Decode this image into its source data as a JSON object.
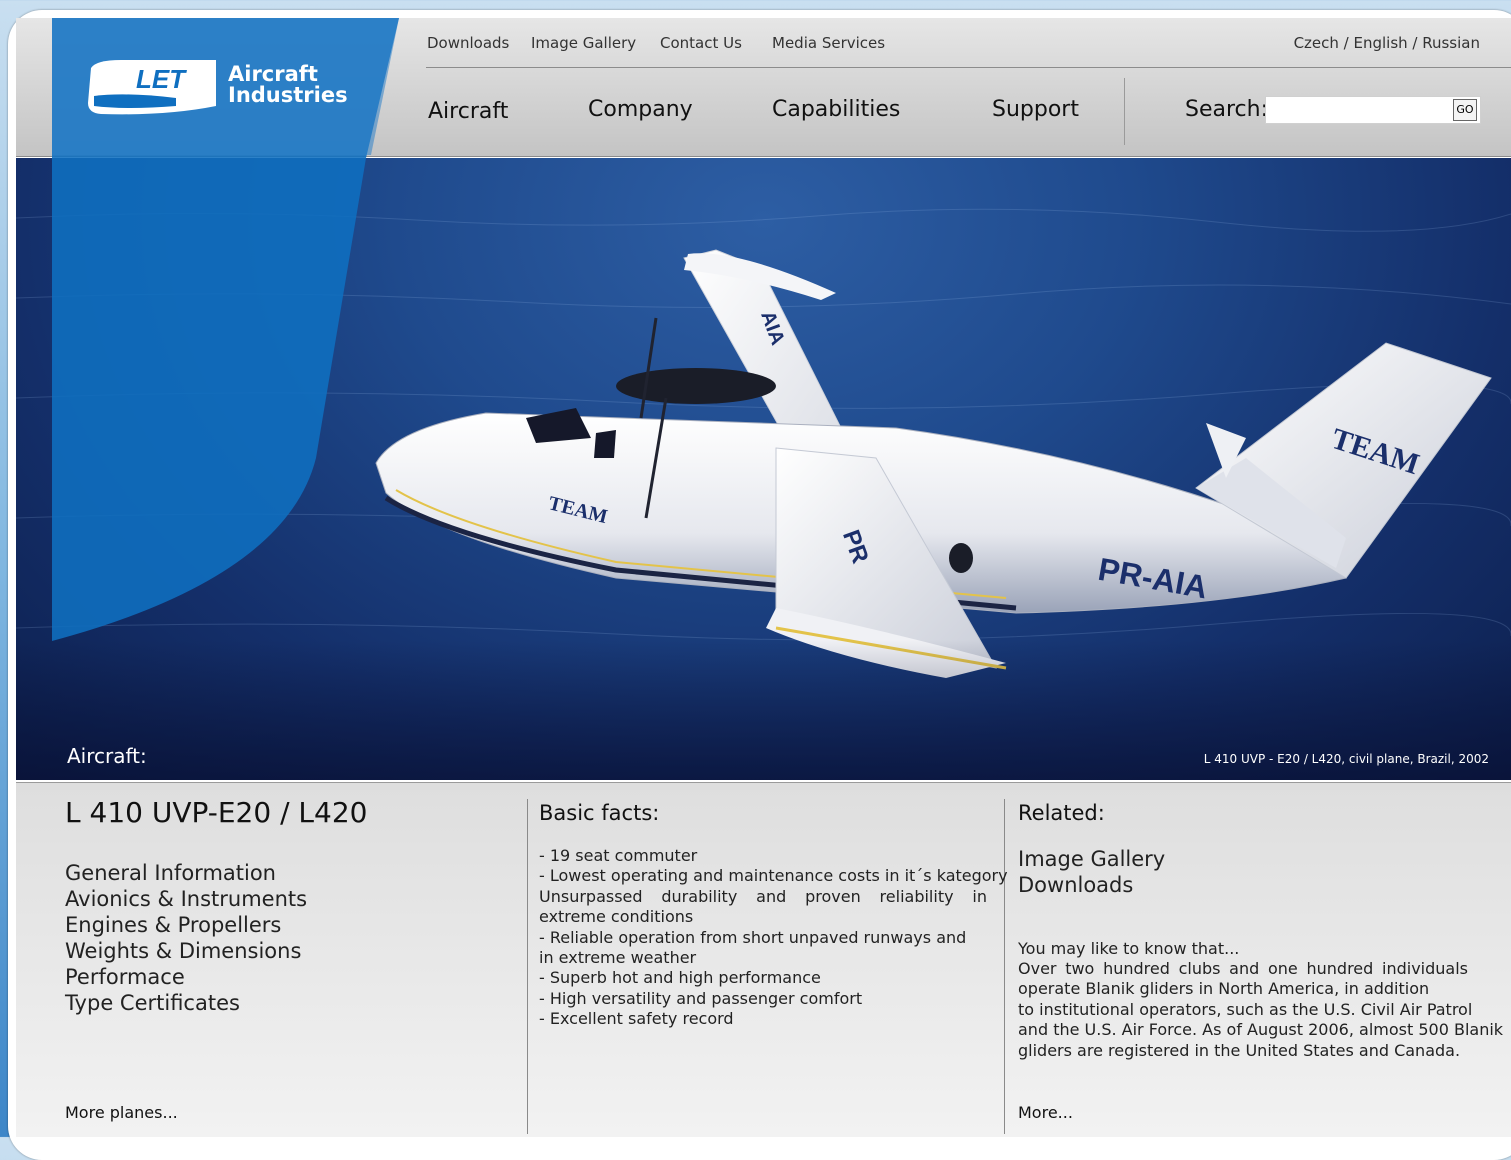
{
  "util_nav": [
    "Downloads",
    "Image Gallery",
    "Contact Us",
    "Media Services"
  ],
  "languages": "Czech / English / Russian",
  "main_nav": [
    "Aircraft",
    "Company",
    "Capabilities",
    "Support"
  ],
  "search": {
    "label": "Search:",
    "value": "",
    "button": "GO"
  },
  "logo": {
    "mark": "LET",
    "line1": "Aircraft",
    "line2": "Industries"
  },
  "hero": {
    "label": "Aircraft:",
    "caption": "L 410 UVP - E20 / L420, civil plane, Brazil, 2002",
    "plane_markings": {
      "tail": "TEAM",
      "fuselage": "TEAM",
      "registration": "PR-AIA",
      "wing_upper": "AIA",
      "wing_lower": "PR"
    }
  },
  "aircraft": {
    "title": "L 410 UVP-E20 / L420",
    "links": [
      "General Information",
      "Avionics & Instruments",
      "Engines & Propellers",
      "Weights & Dimensions",
      "Performace",
      "Type Certificates"
    ],
    "more": "More planes..."
  },
  "facts": {
    "title": "Basic facts:",
    "items": [
      "- 19 seat commuter",
      "- Lowest operating and maintenance costs in it´s kategory",
      "Unsurpassed durability and proven reliability in extreme conditions",
      "- Reliable operation from short unpaved runways and",
      "in extreme weather",
      "- Superb hot and high performance",
      "- High versatility and passenger comfort",
      "- Excellent safety record"
    ]
  },
  "related": {
    "title": "Related:",
    "links": [
      "Image Gallery",
      "Downloads"
    ],
    "know_title": "You may like to know that...",
    "know_lines": [
      "Over two hundred clubs and one hundred individuals",
      "operate Blanik gliders in North America, in addition",
      "to institutional operators, such as the U.S. Civil Air Patrol",
      "and the U.S. Air Force. As of August 2006, almost 500 Blanik",
      "gliders are registered in the United States and Canada."
    ],
    "more": "More..."
  }
}
